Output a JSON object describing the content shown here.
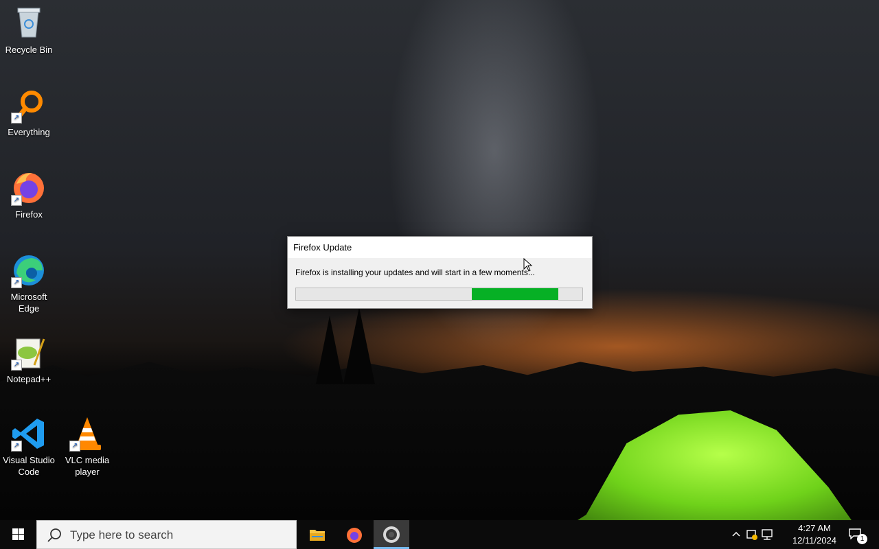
{
  "desktop": {
    "icons": [
      {
        "label": "Recycle Bin",
        "icon": "recycle-bin-icon"
      },
      {
        "label": "Everything",
        "icon": "search-magnifier-icon"
      },
      {
        "label": "Firefox",
        "icon": "firefox-icon"
      },
      {
        "label": "Microsoft Edge",
        "icon": "edge-icon"
      },
      {
        "label": "Notepad++",
        "icon": "notepadpp-icon"
      },
      {
        "label": "Visual Studio Code",
        "icon": "vscode-icon"
      },
      {
        "label": "VLC media player",
        "icon": "vlc-icon"
      }
    ]
  },
  "dialog": {
    "title": "Firefox Update",
    "message": "Firefox is installing your updates and will start in a few moments...",
    "progress_fraction": 0.3
  },
  "taskbar": {
    "search_placeholder": "Type here to search",
    "time": "4:27 AM",
    "date": "12/11/2024",
    "notification_count": "1"
  },
  "colors": {
    "progress_fill": "#06b025",
    "taskbar_bg": "#0b0b0b",
    "active_app_underline": "#76b9ed"
  }
}
